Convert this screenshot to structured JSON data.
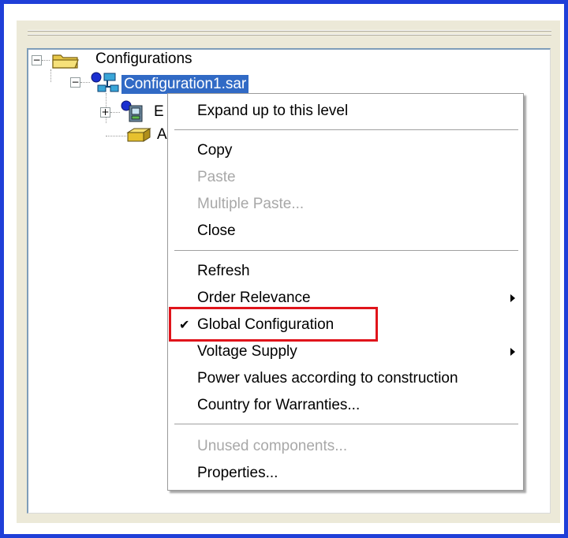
{
  "tree": {
    "root_label": "Configurations",
    "config_label": "Configuration1.sar",
    "child1_label_partial": "E",
    "child2_label_partial": "A"
  },
  "context_menu": {
    "items": [
      {
        "label": "Expand up to this level",
        "enabled": true
      },
      {
        "label": "Copy",
        "enabled": true
      },
      {
        "label": "Paste",
        "enabled": false
      },
      {
        "label": "Multiple Paste...",
        "enabled": false
      },
      {
        "label": "Close",
        "enabled": true
      },
      {
        "label": "Refresh",
        "enabled": true
      },
      {
        "label": "Order Relevance",
        "enabled": true,
        "submenu": true
      },
      {
        "label": "Global Configuration",
        "enabled": true,
        "checked": true
      },
      {
        "label": "Voltage Supply",
        "enabled": true,
        "submenu": true
      },
      {
        "label": "Power values according to construction",
        "enabled": true
      },
      {
        "label": "Country for Warranties...",
        "enabled": true
      },
      {
        "label": "Unused components...",
        "enabled": false
      },
      {
        "label": "Properties...",
        "enabled": true
      }
    ],
    "check_glyph": "✔"
  },
  "colors": {
    "frame_border": "#1f3fd8",
    "selection": "#316ac5",
    "highlight_box": "#e0141b",
    "disabled_text": "#a8a8a8"
  },
  "icons": {
    "root": "folder-open-icon",
    "config": "network-config-icon",
    "child1": "device-icon",
    "child2": "component-box-icon"
  }
}
